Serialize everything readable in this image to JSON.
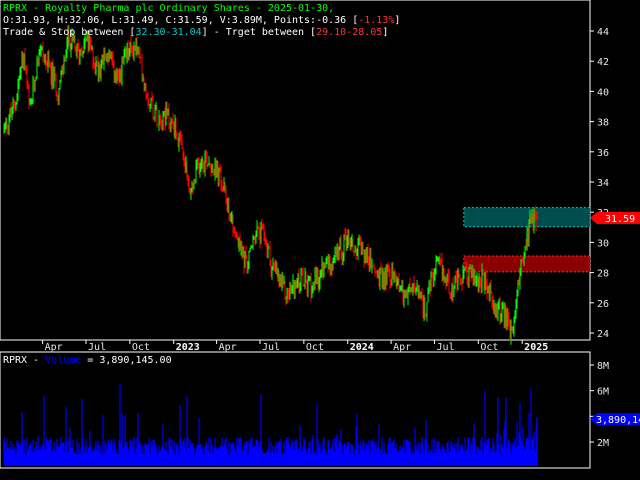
{
  "header": {
    "line1_a": "RPRX - Royalty Pharma plc  Ordinary Shares - 2025-01-30,",
    "line2_a": "O:31.93, H:32.06, L:31.49, C:31.59, V:3.89M, Points:-0.36 [",
    "line2_b": "-1.13%",
    "line2_c": "]",
    "line3_a": "Trade & Stop between [",
    "line3_b": "32.30-31.04",
    "line3_c": "] - Trget between [",
    "line3_d": "29.10-28.05",
    "line3_e": "]"
  },
  "volume_header": {
    "prefix": "RPRX - ",
    "series": "Volume",
    "suffix": " = 3,890,145.00"
  },
  "price_tag": "31.59",
  "volume_tag": "3,890,14",
  "colors": {
    "background": "#000000",
    "up": "#00ff00",
    "down": "#ff0000",
    "volume": "#0000ff",
    "header_green": "#00ff00",
    "header_cyan": "#00cccc",
    "header_red": "#ff3333",
    "trade_zone": "#004d4d",
    "target_zone": "#8b0000"
  },
  "chart_data": [
    {
      "type": "candlestick",
      "title": "RPRX - Royalty Pharma plc  Ordinary Shares - 2025-01-30,",
      "y_ticks": [
        "44",
        "42",
        "40",
        "38",
        "36",
        "34",
        "32",
        "30",
        "28",
        "26",
        "24"
      ],
      "ylim": [
        23,
        45
      ],
      "x_ticks": [
        {
          "label": "Apr",
          "date": "2022-04-01",
          "bold": false
        },
        {
          "label": "Jul",
          "date": "2022-07-01",
          "bold": false
        },
        {
          "label": "Oct",
          "date": "2022-10-01",
          "bold": false
        },
        {
          "label": "2023",
          "date": "2023-01-01",
          "bold": true
        },
        {
          "label": "Apr",
          "date": "2023-04-01",
          "bold": false
        },
        {
          "label": "Jul",
          "date": "2023-07-01",
          "bold": false
        },
        {
          "label": "Oct",
          "date": "2023-10-01",
          "bold": false
        },
        {
          "label": "2024",
          "date": "2024-01-01",
          "bold": true
        },
        {
          "label": "Apr",
          "date": "2024-04-01",
          "bold": false
        },
        {
          "label": "Jul",
          "date": "2024-07-01",
          "bold": false
        },
        {
          "label": "Oct",
          "date": "2024-10-01",
          "bold": false
        },
        {
          "label": "2025",
          "date": "2025-01-01",
          "bold": true
        }
      ],
      "x_range": [
        "2022-01-10",
        "2025-01-30"
      ],
      "close_path": [
        {
          "date": "2022-01-10",
          "close": 37.5
        },
        {
          "date": "2022-02-01",
          "close": 39.0
        },
        {
          "date": "2022-02-20",
          "close": 42.5
        },
        {
          "date": "2022-03-05",
          "close": 38.5
        },
        {
          "date": "2022-03-25",
          "close": 43.0
        },
        {
          "date": "2022-04-15",
          "close": 41.5
        },
        {
          "date": "2022-05-05",
          "close": 40.0
        },
        {
          "date": "2022-05-25",
          "close": 43.5
        },
        {
          "date": "2022-06-15",
          "close": 42.5
        },
        {
          "date": "2022-07-01",
          "close": 43.5
        },
        {
          "date": "2022-07-25",
          "close": 41.5
        },
        {
          "date": "2022-08-15",
          "close": 42.5
        },
        {
          "date": "2022-09-05",
          "close": 40.5
        },
        {
          "date": "2022-09-25",
          "close": 42.5
        },
        {
          "date": "2022-10-15",
          "close": 43.0
        },
        {
          "date": "2022-11-05",
          "close": 40.0
        },
        {
          "date": "2022-11-25",
          "close": 38.5
        },
        {
          "date": "2022-12-15",
          "close": 38.5
        },
        {
          "date": "2023-01-05",
          "close": 37.5
        },
        {
          "date": "2023-01-25",
          "close": 35.0
        },
        {
          "date": "2023-02-05",
          "close": 33.0
        },
        {
          "date": "2023-02-25",
          "close": 35.5
        },
        {
          "date": "2023-03-15",
          "close": 35.5
        },
        {
          "date": "2023-04-05",
          "close": 34.5
        },
        {
          "date": "2023-04-25",
          "close": 32.5
        },
        {
          "date": "2023-05-15",
          "close": 30.0
        },
        {
          "date": "2023-06-05",
          "close": 28.5
        },
        {
          "date": "2023-06-20",
          "close": 30.5
        },
        {
          "date": "2023-07-10",
          "close": 30.5
        },
        {
          "date": "2023-07-25",
          "close": 28.5
        },
        {
          "date": "2023-08-10",
          "close": 27.5
        },
        {
          "date": "2023-08-25",
          "close": 26.5
        },
        {
          "date": "2023-09-10",
          "close": 27.0
        },
        {
          "date": "2023-09-25",
          "close": 27.5
        },
        {
          "date": "2023-10-10",
          "close": 27.0
        },
        {
          "date": "2023-10-30",
          "close": 27.5
        },
        {
          "date": "2023-11-15",
          "close": 28.5
        },
        {
          "date": "2023-12-05",
          "close": 29.0
        },
        {
          "date": "2023-12-20",
          "close": 29.5
        },
        {
          "date": "2023-12-30",
          "close": 30.5
        },
        {
          "date": "2024-01-15",
          "close": 29.5
        },
        {
          "date": "2024-02-01",
          "close": 29.5
        },
        {
          "date": "2024-02-20",
          "close": 28.5
        },
        {
          "date": "2024-03-10",
          "close": 27.5
        },
        {
          "date": "2024-03-25",
          "close": 28.0
        },
        {
          "date": "2024-04-15",
          "close": 27.5
        },
        {
          "date": "2024-05-01",
          "close": 26.5
        },
        {
          "date": "2024-05-20",
          "close": 27.0
        },
        {
          "date": "2024-06-10",
          "close": 25.5
        },
        {
          "date": "2024-06-25",
          "close": 27.5
        },
        {
          "date": "2024-07-10",
          "close": 28.5
        },
        {
          "date": "2024-07-25",
          "close": 27.5
        },
        {
          "date": "2024-08-10",
          "close": 27.0
        },
        {
          "date": "2024-08-25",
          "close": 27.5
        },
        {
          "date": "2024-09-10",
          "close": 28.0
        },
        {
          "date": "2024-09-25",
          "close": 27.5
        },
        {
          "date": "2024-10-10",
          "close": 27.5
        },
        {
          "date": "2024-10-25",
          "close": 26.5
        },
        {
          "date": "2024-11-10",
          "close": 25.5
        },
        {
          "date": "2024-11-25",
          "close": 25.0
        },
        {
          "date": "2024-12-10",
          "close": 24.0
        },
        {
          "date": "2024-12-20",
          "close": 26.0
        },
        {
          "date": "2024-12-31",
          "close": 28.5
        },
        {
          "date": "2025-01-15",
          "close": 31.0
        },
        {
          "date": "2025-01-30",
          "close": 31.59
        }
      ],
      "last_bar": {
        "open": 31.93,
        "high": 32.06,
        "low": 31.49,
        "close": 31.59
      },
      "zones": [
        {
          "label": "Trade & Stop",
          "from_date": "2024-12-25",
          "to_date": "2025-03-25",
          "high": 32.3,
          "low": 31.04
        },
        {
          "label": "Trget",
          "from_date": "2024-12-25",
          "to_date": "2025-03-25",
          "high": 29.1,
          "low": 28.05
        }
      ]
    },
    {
      "type": "bar",
      "title": "Volume",
      "y_ticks": [
        "8M",
        "6M",
        "4M",
        "2M"
      ],
      "ylim": [
        0,
        9000000
      ],
      "last_value": 3890145,
      "baseline": 2000000,
      "peak": 8000000
    }
  ]
}
